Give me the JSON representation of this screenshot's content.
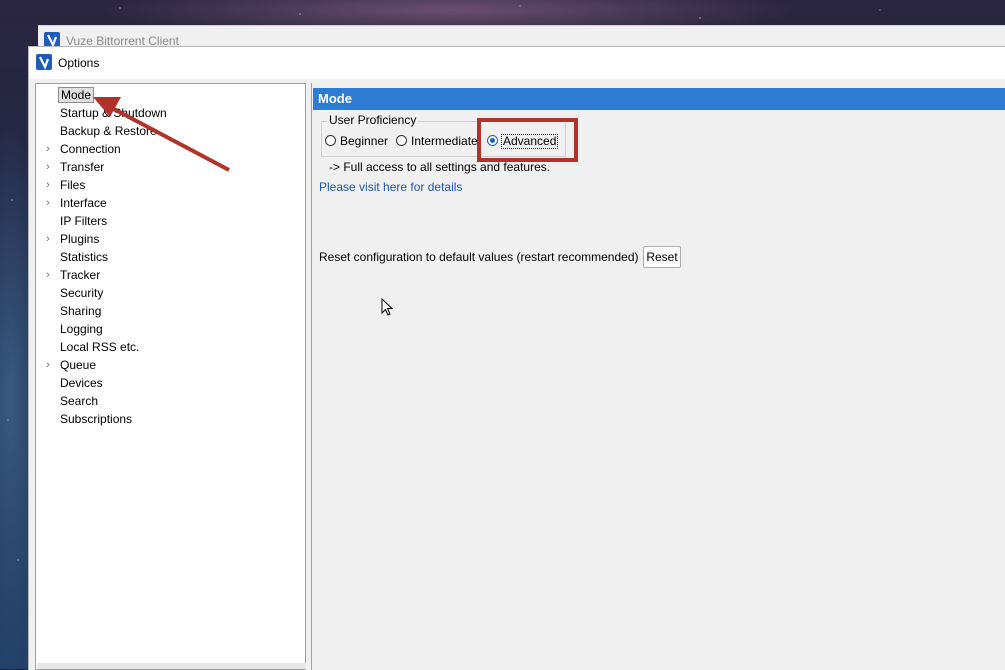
{
  "background_window": {
    "title": "Vuze Bittorrent Client"
  },
  "options_window": {
    "title": "Options"
  },
  "sidebar": {
    "items": [
      {
        "label": "Mode",
        "expandable": false,
        "selected": true
      },
      {
        "label": "Startup & Shutdown",
        "expandable": false
      },
      {
        "label": "Backup & Restore",
        "expandable": false
      },
      {
        "label": "Connection",
        "expandable": true
      },
      {
        "label": "Transfer",
        "expandable": true
      },
      {
        "label": "Files",
        "expandable": true
      },
      {
        "label": "Interface",
        "expandable": true
      },
      {
        "label": "IP Filters",
        "expandable": false
      },
      {
        "label": "Plugins",
        "expandable": true
      },
      {
        "label": "Statistics",
        "expandable": false
      },
      {
        "label": "Tracker",
        "expandable": true
      },
      {
        "label": "Security",
        "expandable": false
      },
      {
        "label": "Sharing",
        "expandable": false
      },
      {
        "label": "Logging",
        "expandable": false
      },
      {
        "label": "Local RSS etc.",
        "expandable": false
      },
      {
        "label": "Queue",
        "expandable": true
      },
      {
        "label": "Devices",
        "expandable": false
      },
      {
        "label": "Search",
        "expandable": false
      },
      {
        "label": "Subscriptions",
        "expandable": false
      }
    ]
  },
  "main": {
    "header": "Mode",
    "proficiency": {
      "legend": "User Proficiency",
      "options": [
        {
          "label": "Beginner",
          "checked": false
        },
        {
          "label": "Intermediate",
          "checked": false
        },
        {
          "label": "Advanced",
          "checked": true
        }
      ]
    },
    "description": "-> Full access to all settings and features.",
    "details_link": "Please visit here for details",
    "reset_text": "Reset configuration to default values (restart recommended)",
    "reset_button": "Reset"
  },
  "colors": {
    "header_bg": "#2e7bd6",
    "annotation": "#b0332a",
    "link": "#1e56a8"
  }
}
